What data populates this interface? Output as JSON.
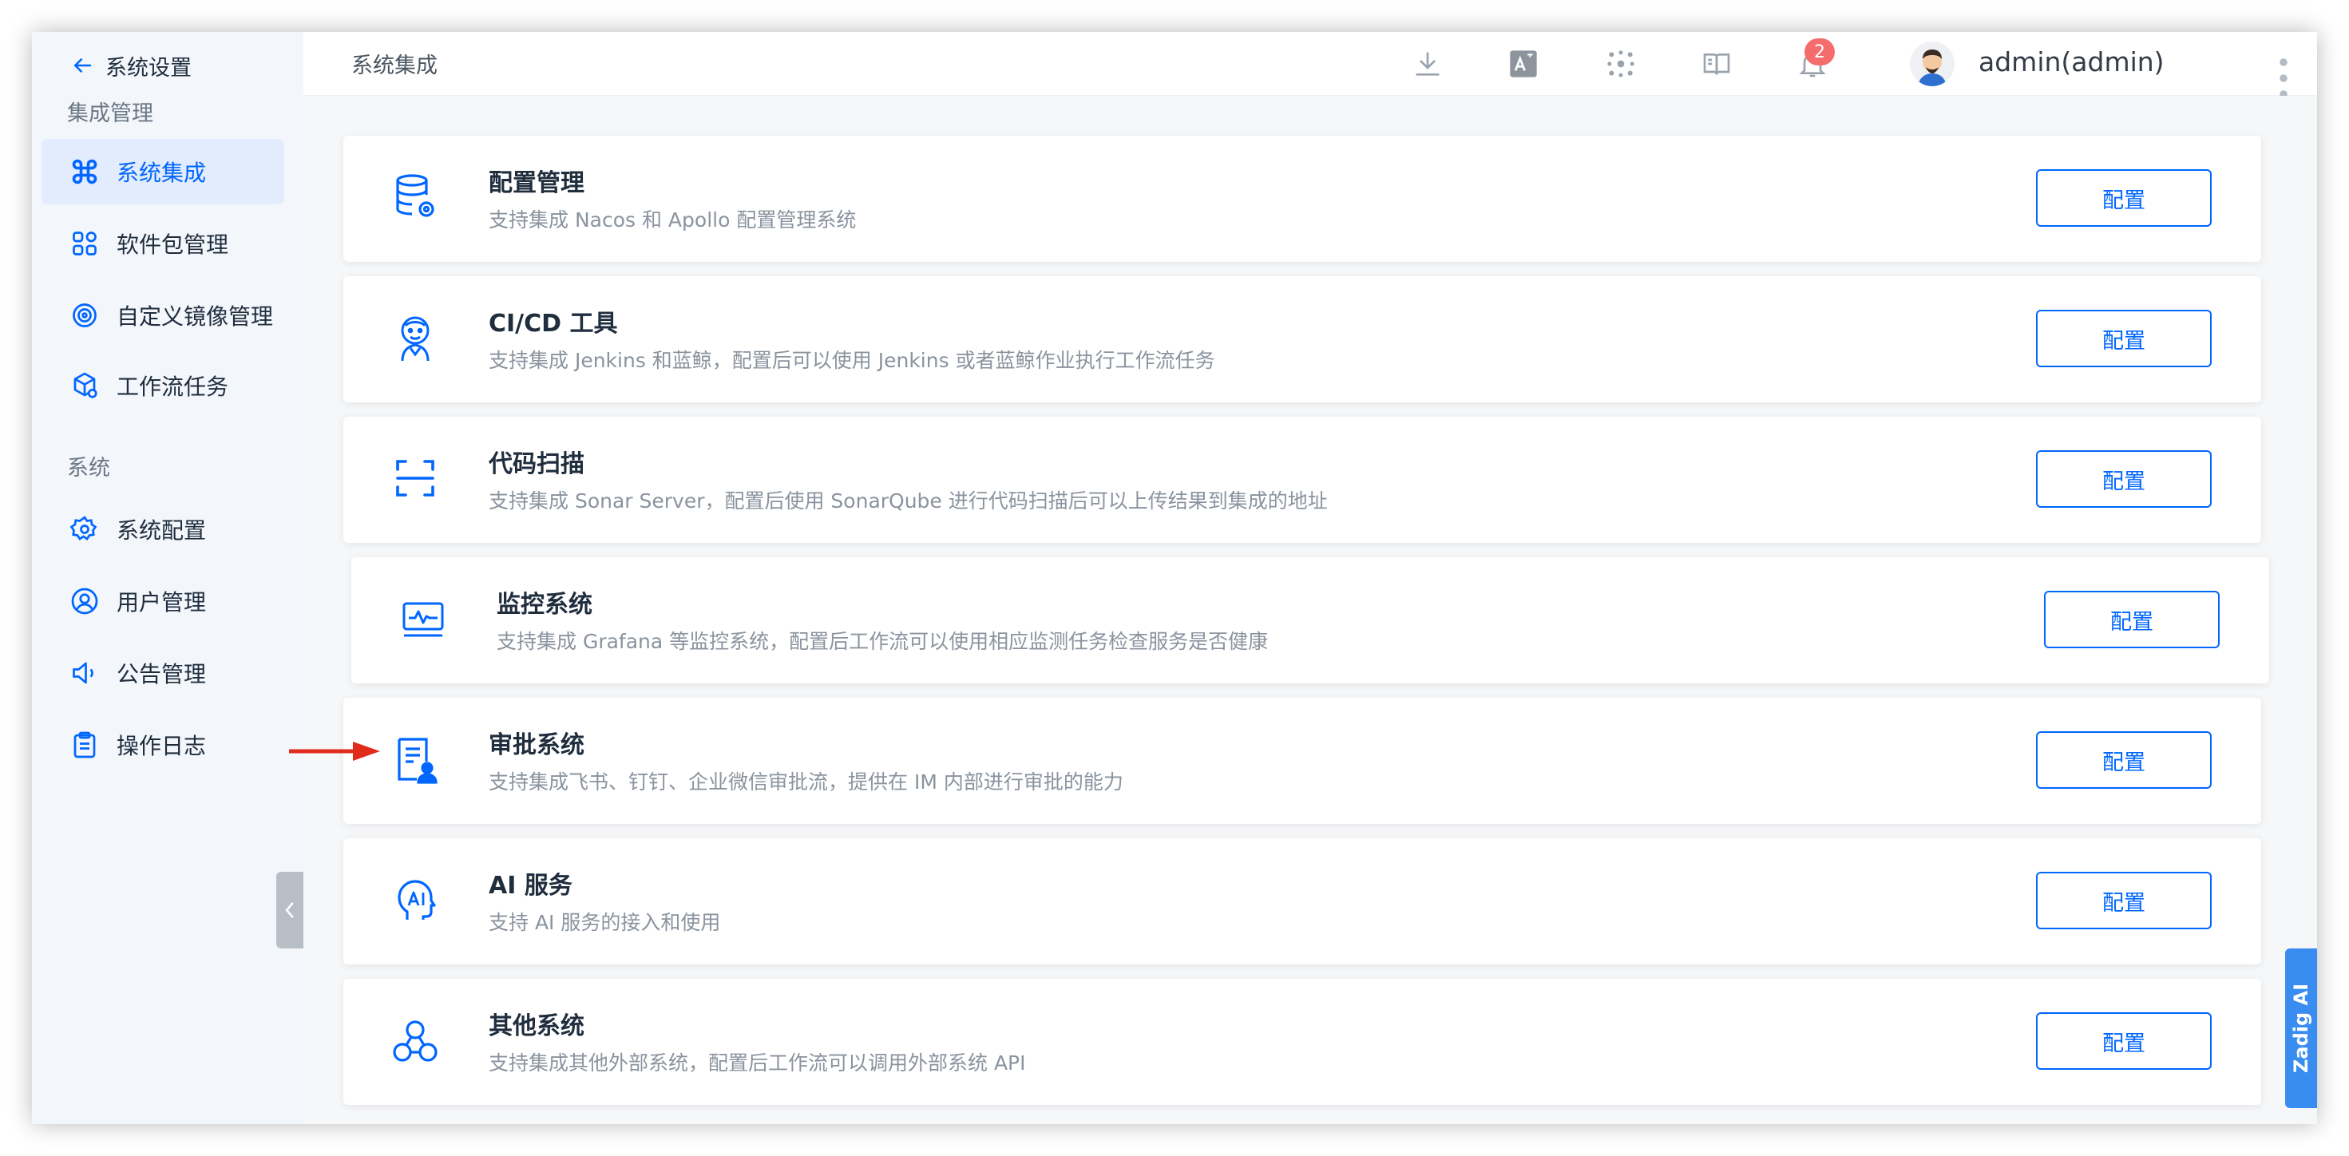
{
  "sidebar": {
    "back_label": "系统设置",
    "groups": [
      {
        "label": "集成管理",
        "items": [
          {
            "label": "系统集成",
            "icon": "command-icon",
            "active": true
          },
          {
            "label": "软件包管理",
            "icon": "apps-grid-icon",
            "active": false
          },
          {
            "label": "自定义镜像管理",
            "icon": "disc-icon",
            "active": false
          },
          {
            "label": "工作流任务",
            "icon": "box-gear-icon",
            "active": false
          }
        ]
      },
      {
        "label": "系统",
        "items": [
          {
            "label": "系统配置",
            "icon": "gear-icon",
            "active": false
          },
          {
            "label": "用户管理",
            "icon": "user-circle-icon",
            "active": false
          },
          {
            "label": "公告管理",
            "icon": "speaker-icon",
            "active": false
          },
          {
            "label": "操作日志",
            "icon": "clipboard-icon",
            "active": false
          }
        ]
      }
    ]
  },
  "header": {
    "title": "系统集成",
    "notification_count": "2",
    "username": "admin(admin)"
  },
  "integrations": [
    {
      "title": "配置管理",
      "desc": "支持集成 Nacos 和 Apollo 配置管理系统",
      "button": "配置",
      "icon": "database-gear-icon"
    },
    {
      "title": "CI/CD 工具",
      "desc": "支持集成 Jenkins 和蓝鲸，配置后可以使用 Jenkins 或者蓝鲸作业执行工作流任务",
      "button": "配置",
      "icon": "jenkins-icon"
    },
    {
      "title": "代码扫描",
      "desc": "支持集成 Sonar Server，配置后使用 SonarQube 进行代码扫描后可以上传结果到集成的地址",
      "button": "配置",
      "icon": "scan-icon"
    },
    {
      "title": "监控系统",
      "desc": "支持集成 Grafana 等监控系统，配置后工作流可以使用相应监测任务检查服务是否健康",
      "button": "配置",
      "icon": "monitor-pulse-icon"
    },
    {
      "title": "审批系统",
      "desc": "支持集成飞书、钉钉、企业微信审批流，提供在 IM 内部进行审批的能力",
      "button": "配置",
      "icon": "document-user-icon"
    },
    {
      "title": "AI 服务",
      "desc": "支持 AI 服务的接入和使用",
      "button": "配置",
      "icon": "ai-head-icon"
    },
    {
      "title": "其他系统",
      "desc": "支持集成其他外部系统，配置后工作流可以调用外部系统 API",
      "button": "配置",
      "icon": "nodes-icon"
    }
  ],
  "assistant_tab": "Zadig AI",
  "colors": {
    "accent": "#0066ff",
    "active_bg": "#e3ecfd",
    "badge": "#f56c6c",
    "arrow": "#e02a1a"
  }
}
